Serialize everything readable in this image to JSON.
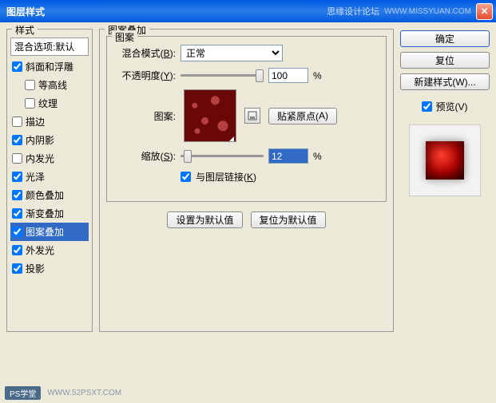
{
  "titlebar": {
    "title": "图层样式",
    "brand": "思缘设计论坛",
    "url": "WWW.MISSYUAN.COM"
  },
  "styles_group": {
    "legend": "样式"
  },
  "style_items": [
    {
      "label": "混合选项:默认",
      "checked": null,
      "header": true,
      "selected": false,
      "sub": false
    },
    {
      "label": "斜面和浮雕",
      "checked": true,
      "header": false,
      "selected": false,
      "sub": false
    },
    {
      "label": "等高线",
      "checked": false,
      "header": false,
      "selected": false,
      "sub": true
    },
    {
      "label": "纹理",
      "checked": false,
      "header": false,
      "selected": false,
      "sub": true
    },
    {
      "label": "描边",
      "checked": false,
      "header": false,
      "selected": false,
      "sub": false
    },
    {
      "label": "内阴影",
      "checked": true,
      "header": false,
      "selected": false,
      "sub": false
    },
    {
      "label": "内发光",
      "checked": false,
      "header": false,
      "selected": false,
      "sub": false
    },
    {
      "label": "光泽",
      "checked": true,
      "header": false,
      "selected": false,
      "sub": false
    },
    {
      "label": "颜色叠加",
      "checked": true,
      "header": false,
      "selected": false,
      "sub": false
    },
    {
      "label": "渐变叠加",
      "checked": true,
      "header": false,
      "selected": false,
      "sub": false
    },
    {
      "label": "图案叠加",
      "checked": true,
      "header": false,
      "selected": true,
      "sub": false
    },
    {
      "label": "外发光",
      "checked": true,
      "header": false,
      "selected": false,
      "sub": false
    },
    {
      "label": "投影",
      "checked": true,
      "header": false,
      "selected": false,
      "sub": false
    }
  ],
  "center": {
    "group_legend": "图案叠加",
    "inner_legend": "图案",
    "blend_label": "混合模式(",
    "blend_hotkey": "B",
    "blend_label2": "):",
    "blend_value": "正常",
    "opacity_label": "不透明度(",
    "opacity_hotkey": "Y",
    "opacity_label2": "):",
    "opacity_value": "100",
    "opacity_unit": "%",
    "pattern_label": "图案:",
    "snap_label": "贴紧原点(",
    "snap_hotkey": "A",
    "snap_label2": ")",
    "scale_label": "缩放(",
    "scale_hotkey": "S",
    "scale_label2": "):",
    "scale_value": "12",
    "scale_unit": "%",
    "link_label": "与图层链接(",
    "link_hotkey": "K",
    "link_label2": ")",
    "set_default": "设置为默认值",
    "reset_default": "复位为默认值"
  },
  "right": {
    "ok": "确定",
    "cancel": "复位",
    "new_style": "新建样式(",
    "new_style_hotkey": "W",
    "new_style2": ")...",
    "preview_label": "预览(",
    "preview_hotkey": "V",
    "preview_label2": ")"
  },
  "footer": {
    "tag": "PS学堂",
    "url": "WWW.52PSXT.COM"
  }
}
